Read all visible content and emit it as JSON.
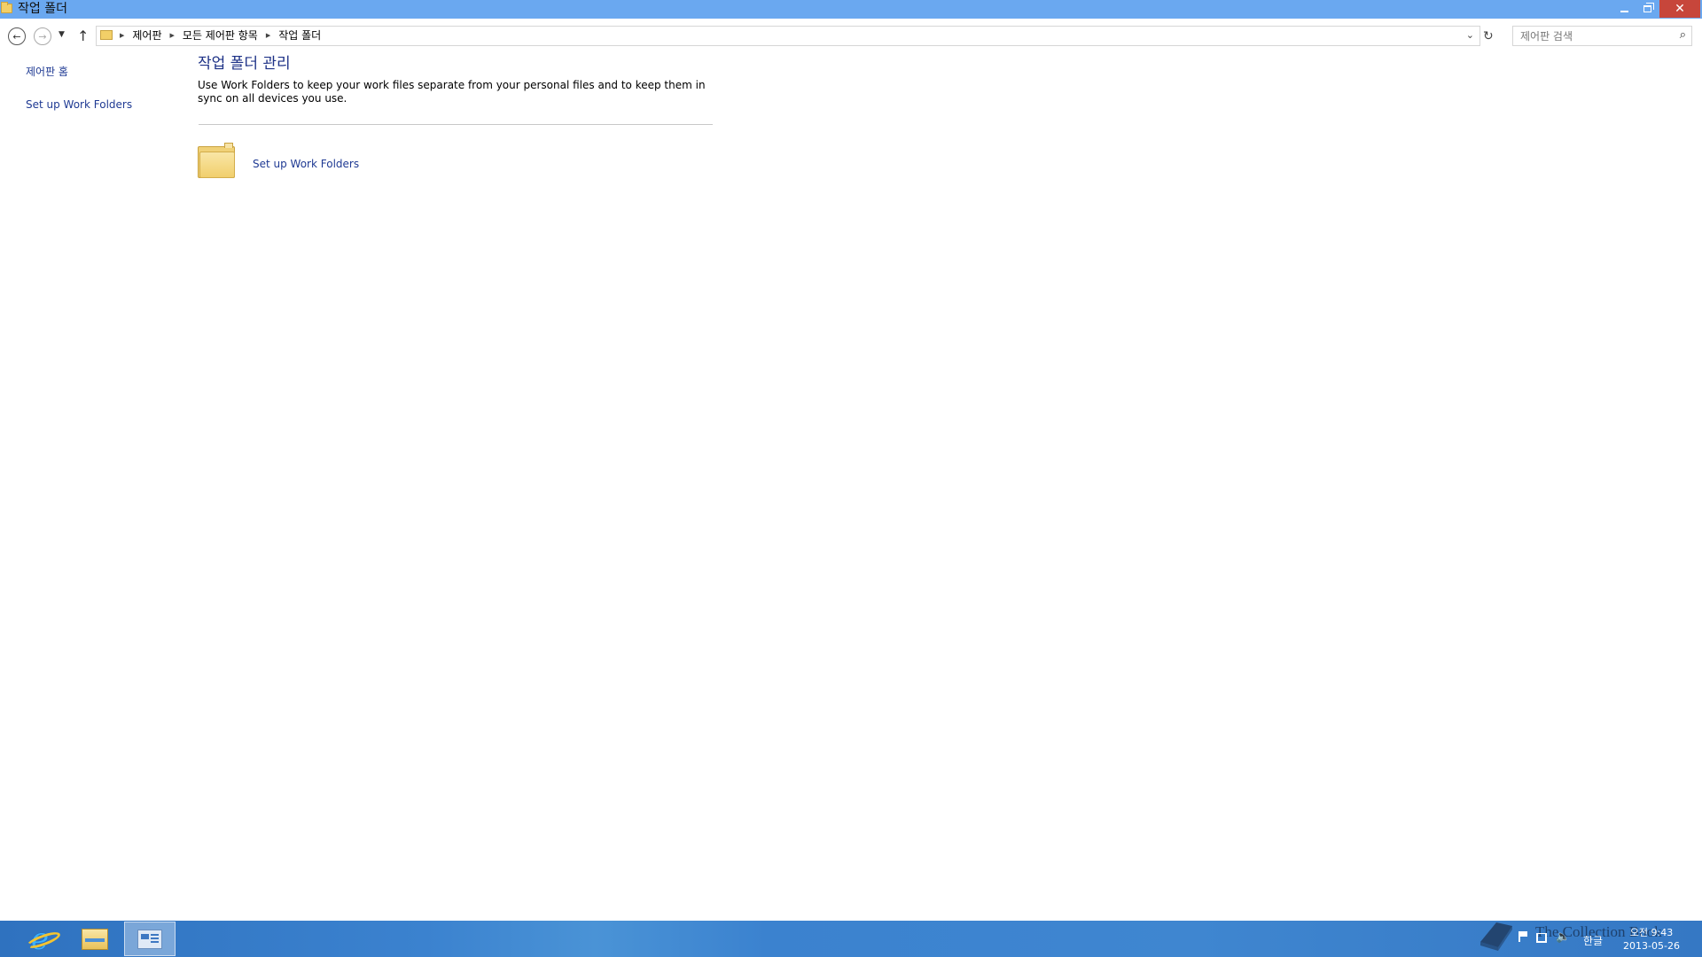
{
  "window": {
    "title": "작업 폴더",
    "minimize_label": "",
    "maximize_label": "",
    "close_label": "✕"
  },
  "nav": {
    "back_glyph": "←",
    "forward_glyph": "→",
    "dropdown_glyph": "▼",
    "up_glyph": "↑",
    "breadcrumb": [
      "제어판",
      "모든 제어판 항목",
      "작업 폴더"
    ],
    "separator_glyph": "▶",
    "address_dropdown_glyph": "⌄",
    "refresh_glyph": "↻",
    "search_placeholder": "제어판 검색",
    "search_glyph": "⌕"
  },
  "sidebar": {
    "home_label": "제어판 홈",
    "setup_label": "Set up Work Folders"
  },
  "main": {
    "heading": "작업 폴더 관리",
    "description": "Use Work Folders to keep your work files separate from your personal files and to keep them in sync on all devices you use.",
    "setup_link": "Set up Work Folders"
  },
  "taskbar": {
    "pinned": [
      {
        "icon": "internet-explorer-icon"
      },
      {
        "icon": "file-explorer-icon"
      },
      {
        "icon": "control-panel-icon",
        "active": true
      }
    ],
    "tray": {
      "ime_label": "한글",
      "time": "오전 9:43",
      "date": "2013-05-26"
    },
    "watermark_text": "The Collection Book"
  },
  "colors": {
    "titlebar": "#6aa8f0",
    "close_button": "#c7463b",
    "link": "#1f3a93",
    "heading": "#1e3287",
    "taskbar": "#3b82cf"
  }
}
